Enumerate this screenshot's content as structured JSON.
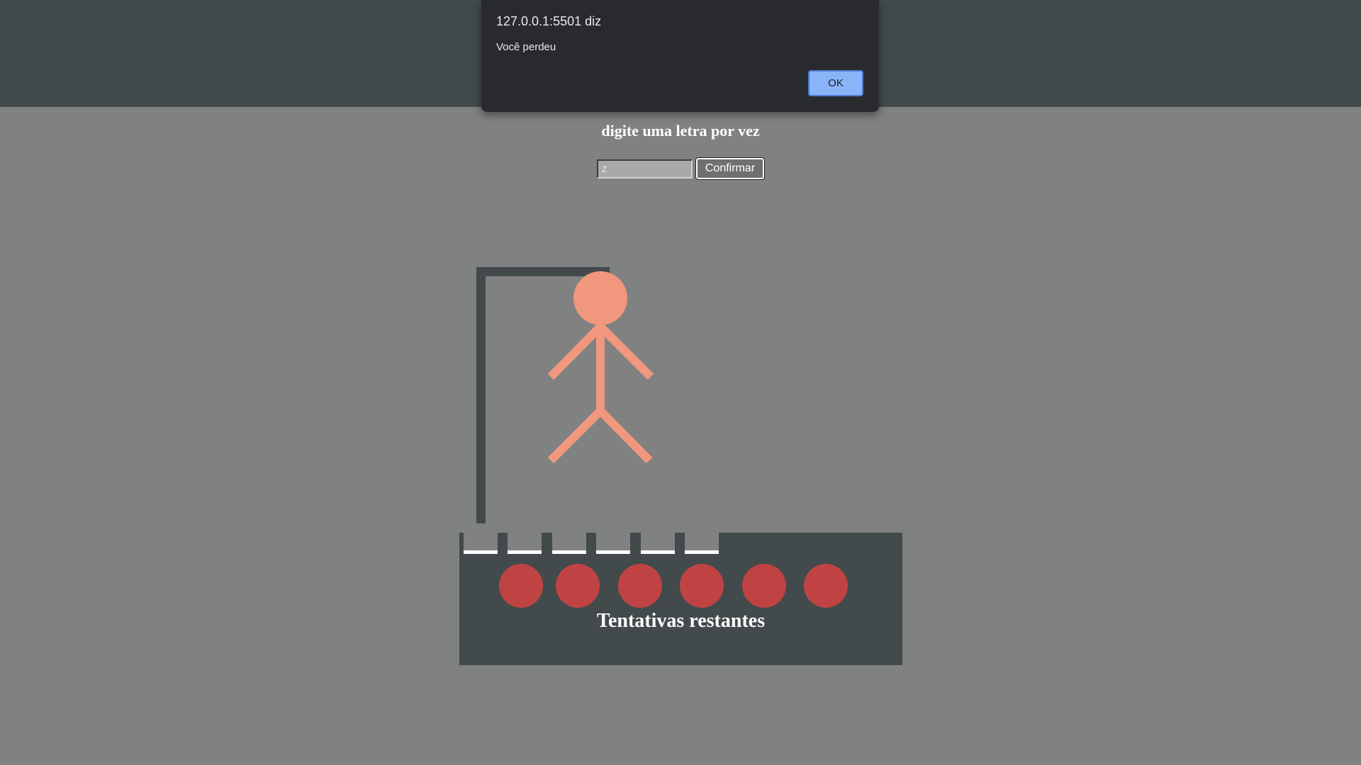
{
  "dialog": {
    "title": "127.0.0.1:5501 diz",
    "message": "Você perdeu",
    "ok_label": "OK"
  },
  "game": {
    "instruction": "digite uma letra por vez",
    "input_value": "z",
    "confirm_label": "Confirmar",
    "attempts_label": "Tentativas restantes",
    "word_slots": [
      "",
      "",
      "",
      "",
      "",
      ""
    ],
    "remaining_attempts": 6
  },
  "colors": {
    "background": "#808281",
    "header": "#424a4b",
    "stickman": "#f0977d",
    "life_dot": "#c04343",
    "dialog_bg": "#292a2d",
    "dialog_button": "#8ab4f8"
  }
}
